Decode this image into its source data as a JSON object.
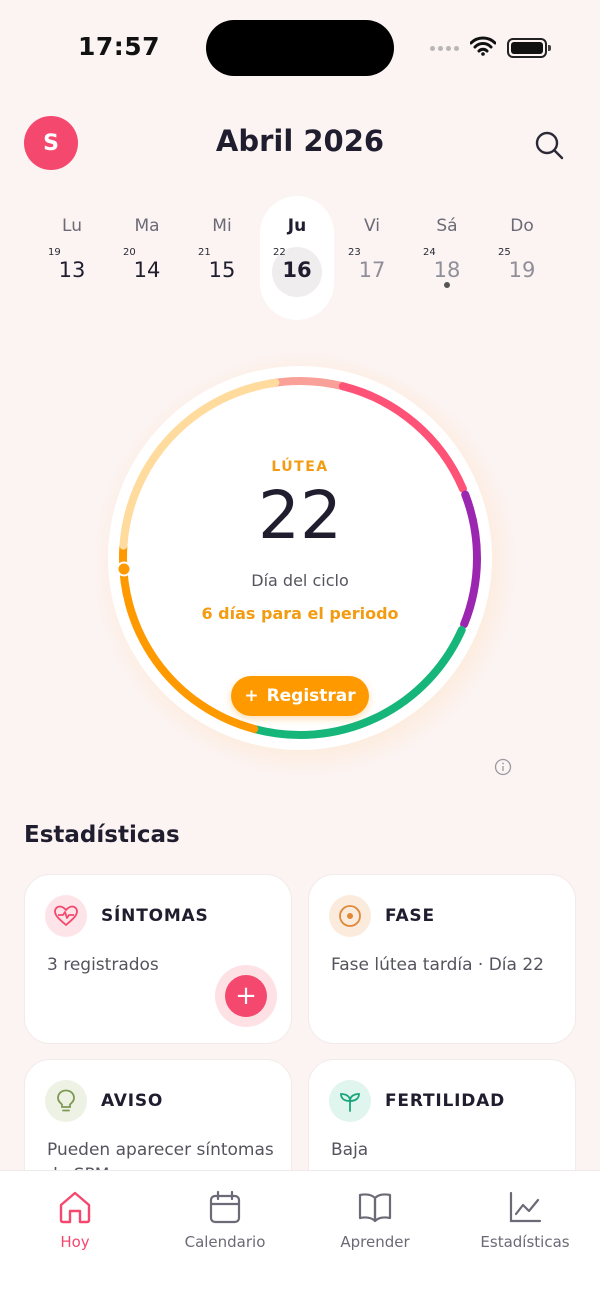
{
  "status_bar": {
    "time": "17:57"
  },
  "header": {
    "avatar_initial": "S",
    "title": "Abril 2026"
  },
  "week": [
    {
      "name": "Lu",
      "small": "19",
      "number": "13"
    },
    {
      "name": "Ma",
      "small": "20",
      "number": "14"
    },
    {
      "name": "Mi",
      "small": "21",
      "number": "15"
    },
    {
      "name": "Ju",
      "small": "22",
      "number": "16",
      "selected": true
    },
    {
      "name": "Vi",
      "small": "23",
      "number": "17"
    },
    {
      "name": "Sá",
      "small": "24",
      "number": "18",
      "has_dot": true
    },
    {
      "name": "Do",
      "small": "25",
      "number": "19"
    }
  ],
  "cycle": {
    "phase": "LÚTEA",
    "day": "22",
    "caption": "Día del ciclo",
    "period_note": "6 días para el periodo",
    "register_label": "Registrar",
    "colors": {
      "menstrual": "#ff5277",
      "follicular": "#9b27b0",
      "fertile": "#16b57a",
      "luteal": "#ff9900",
      "luteal_late": "#ffdb9e",
      "pre_period": "#f9a199"
    }
  },
  "stats": {
    "title": "Estadísticas",
    "cards": [
      {
        "title": "SÍNTOMAS",
        "body": "3 registrados",
        "icon": "heart-pulse-icon"
      },
      {
        "title": "FASE",
        "body": "Fase lútea tardía · Día 22",
        "icon": "target-icon"
      },
      {
        "title": "AVISO",
        "body": "Pueden aparecer síntomas de SPM",
        "icon": "lightbulb-icon"
      },
      {
        "title": "FERTILIDAD",
        "body": "Baja",
        "icon": "sprout-icon"
      }
    ]
  },
  "tabs": [
    {
      "label": "Hoy",
      "icon": "home-icon",
      "active": true
    },
    {
      "label": "Calendario",
      "icon": "calendar-icon"
    },
    {
      "label": "Aprender",
      "icon": "book-icon"
    },
    {
      "label": "Estadísticas",
      "icon": "chart-icon"
    }
  ]
}
